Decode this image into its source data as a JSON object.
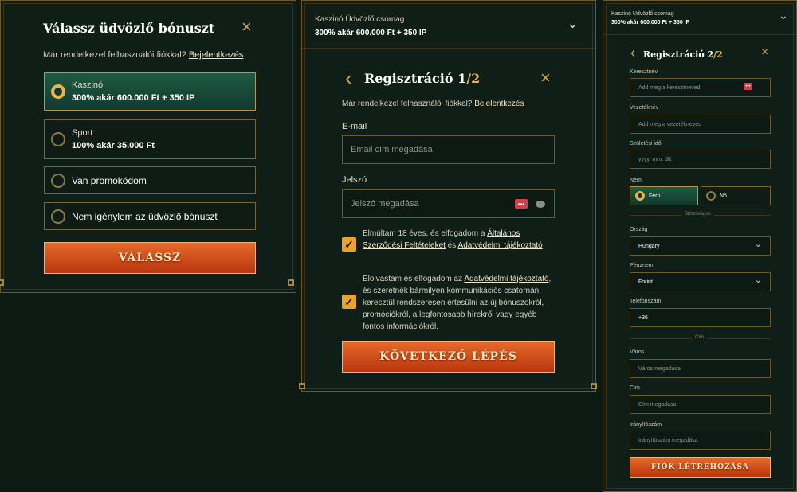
{
  "panel1": {
    "title": "Válassz üdvözlő bónuszt",
    "login_prompt": "Már rendelkezel felhasználói fiókkal?",
    "login_link": "Bejelentkezés",
    "options": [
      {
        "line1": "Kaszinó",
        "line2": "300% akár 600.000 Ft + 350 IP"
      },
      {
        "line1": "Sport",
        "line2": "100% akár 35.000 Ft"
      },
      {
        "line1": "Van promokódom",
        "line2": ""
      },
      {
        "line1": "Nem igénylem az üdvözlő bónuszt",
        "line2": ""
      }
    ],
    "button": "VÁLASSZ",
    "close_icon": "×"
  },
  "panel2": {
    "header_title": "Kaszinó Üdvözlő csomag",
    "header_sub": "300% akár 600.000 Ft + 350 IP",
    "title": "Regisztráció 1",
    "title_step": "/2",
    "login_prompt": "Már rendelkezel felhasználói fiókkal?",
    "login_link": "Bejelentkezés",
    "email_label": "E-mail",
    "email_placeholder": "Email cím megadása",
    "password_label": "Jelszó",
    "password_placeholder": "Jelszó megadása",
    "terms_1": "Elmúltam 18 éves, és elfogadom a",
    "terms_link1": "Általános Szerződési Feltételeket",
    "terms_and": "és",
    "terms_link2": "Adatvédelmi tájékoztató",
    "privacy_1": "Elolvastam és elfogadom az",
    "privacy_link": "Adatvédelmi tájékoztató",
    "privacy_2": ", és szeretnék bármilyen kommunikációs csatornán keresztül rendszeresen értesülni az új bónuszokról, promóciókról, a legfontosabb hírekről vagy egyéb fontos információkról.",
    "button": "KÖVETKEZŐ LÉPÉS",
    "back_icon": "‹",
    "close_icon": "×",
    "chevron_icon": "⌄"
  },
  "panel3": {
    "header_title": "Kaszinó Üdvözlő csomag",
    "header_sub": "300% akár 600.000 Ft + 350 IP",
    "title": "Regisztráció 2",
    "title_step": "/2",
    "first_name_label": "Keresztnév",
    "first_name_placeholder": "Add meg a keresztneved",
    "last_name_label": "Vezetéknév",
    "last_name_placeholder": "Add meg a vezetékneved",
    "dob_label": "Születési idő",
    "dob_placeholder": "yyyy. mm. dd.",
    "gender_label": "Nem",
    "gender_male": "Férfi",
    "gender_female": "Nő",
    "security_divider": "Biztonságos",
    "country_label": "Ország",
    "country_value": "Hungary",
    "currency_label": "Pénznem",
    "currency_value": "Forint",
    "phone_label": "Telefonszám",
    "phone_value": "+36",
    "address_divider": "Cím",
    "city_label": "Város",
    "city_placeholder": "Város megadása",
    "street_label": "Cím",
    "street_placeholder": "Cím megadása",
    "zip_label": "Irányítószám",
    "zip_placeholder": "Irányítószám megadása",
    "button": "FIÓK LÉTREHOZÁSA",
    "back_icon": "‹",
    "close_icon": "×",
    "chevron_icon": "⌄"
  }
}
